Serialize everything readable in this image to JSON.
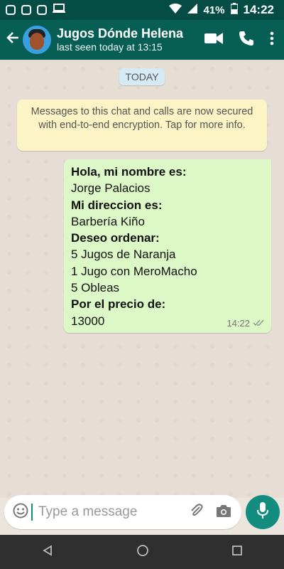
{
  "status_bar": {
    "battery": "41%",
    "time": "14:22",
    "icons": [
      "instagram-icon",
      "instagram-icon",
      "image-icon",
      "laptop-icon",
      "wifi-icon",
      "signal-icon",
      "battery-icon"
    ]
  },
  "header": {
    "contact_name": "Jugos Dónde Helena",
    "last_seen": "last seen today at 13:15"
  },
  "chat": {
    "date_label": "TODAY",
    "encryption_notice": "Messages to this chat and calls are now secured with end-to-end encryption. Tap for more info.",
    "message": {
      "lines": [
        {
          "text": "Hola, mi nombre es:",
          "bold": true
        },
        {
          "text": "Jorge Palacios",
          "bold": false
        },
        {
          "text": "Mi direccion es:",
          "bold": true
        },
        {
          "text": "Barbería Kiño",
          "bold": false
        },
        {
          "text": "Deseo ordenar:",
          "bold": true
        },
        {
          "text": "5 Jugos de Naranja",
          "bold": false
        },
        {
          "text": "1 Jugo con MeroMacho",
          "bold": false
        },
        {
          "text": "5 Obleas",
          "bold": false
        },
        {
          "text": "Por el precio de:",
          "bold": true
        },
        {
          "text": "13000",
          "bold": false
        }
      ],
      "time": "14:22"
    }
  },
  "input": {
    "placeholder": "Type a message"
  },
  "colors": {
    "header": "#075e54",
    "status_bar": "#054d44",
    "outgoing_bubble": "#dcf8c6",
    "notice_bg": "#fdf4c5",
    "accent": "#128c7e"
  }
}
